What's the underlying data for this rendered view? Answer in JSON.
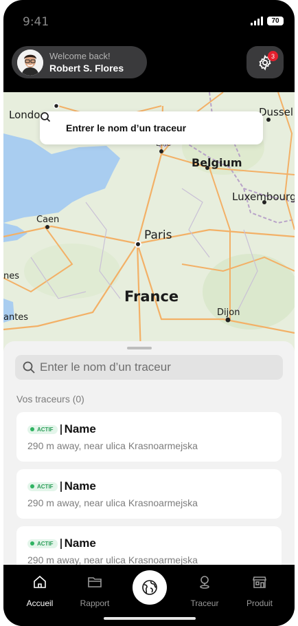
{
  "status_bar": {
    "time": "9:41",
    "battery": "70"
  },
  "header": {
    "welcome": "Welcome back!",
    "user_name": "Robert S. Flores",
    "notification_count": "3"
  },
  "map": {
    "search_placeholder": "Entrer le nom d’un traceur",
    "labels": {
      "london": "Londo",
      "dusseldorf": "Dussel",
      "lille": "Lille",
      "belgium": "Belgium",
      "luxembourg": "Luxembourg",
      "caen": "Caen",
      "paris": "Paris",
      "nes": "nes",
      "france": "France",
      "nantes": "antes",
      "dijon": "Dijon"
    }
  },
  "sheet": {
    "search_placeholder": "Enter le nom d’un traceur",
    "section_title": "Vos traceurs (0)",
    "trackers": [
      {
        "status": "ACTIF",
        "name": "Name",
        "detail": "290 m away, near ulica Krasnoarmejska"
      },
      {
        "status": "ACTIF",
        "name": "Name",
        "detail": "290 m away, near ulica Krasnoarmejska"
      },
      {
        "status": "ACTIF",
        "name": "Name",
        "detail": "290 m away, near ulica Krasnoarmejska"
      }
    ]
  },
  "tabs": [
    {
      "label": "Accueil",
      "icon": "home-icon",
      "active": true
    },
    {
      "label": "Rapport",
      "icon": "folder-icon",
      "active": false
    },
    {
      "label": "",
      "icon": "globe-icon",
      "active": false
    },
    {
      "label": "Traceur",
      "icon": "location-pin-icon",
      "active": false
    },
    {
      "label": "Produit",
      "icon": "store-icon",
      "active": false
    }
  ],
  "colors": {
    "accent_green": "#2fb362",
    "badge_red": "#e4202e",
    "sea": "#a9cdf0",
    "land": "#e7eedd",
    "road": "#f3b066"
  }
}
